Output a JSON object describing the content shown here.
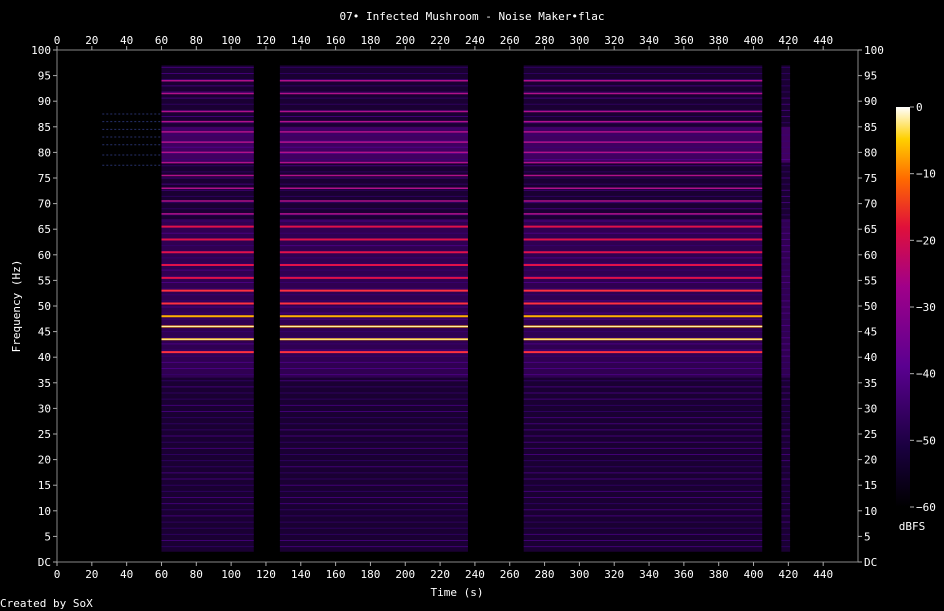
{
  "chart_data": {
    "type": "heatmap",
    "title": "07• Infected Mushroom - Noise Maker•flac",
    "xlabel": "Time (s)",
    "ylabel": "Frequency (Hz)",
    "xlim": [
      0,
      460
    ],
    "ylim": [
      0,
      100
    ],
    "x_ticks": [
      0,
      20,
      40,
      60,
      80,
      100,
      120,
      140,
      160,
      180,
      200,
      220,
      240,
      260,
      280,
      300,
      320,
      340,
      360,
      380,
      400,
      420,
      440
    ],
    "y_ticks": [
      "DC",
      "5",
      "10",
      "15",
      "20",
      "25",
      "30",
      "35",
      "40",
      "45",
      "50",
      "55",
      "60",
      "65",
      "70",
      "75",
      "80",
      "85",
      "90",
      "95",
      "100"
    ],
    "colorbar": {
      "label": "dBFS",
      "range": [
        -60,
        0
      ],
      "ticks": [
        "0",
        "−10",
        "−20",
        "−30",
        "−40",
        "−50",
        "−60"
      ],
      "colors": [
        "#000000",
        "#1a0040",
        "#5a0090",
        "#a0008a",
        "#e0103a",
        "#ff6a00",
        "#ffd000",
        "#ffffff"
      ]
    },
    "active_segments_s": [
      [
        60,
        113
      ],
      [
        128,
        236
      ],
      [
        268,
        405
      ],
      [
        416,
        421
      ]
    ],
    "quiet_segment_s": [
      [
        26,
        60
      ]
    ],
    "strong_partials_hz": [
      41,
      43.5,
      46,
      48,
      50.5,
      53,
      55.5,
      58,
      60.5,
      63,
      65.5
    ]
  },
  "footer": {
    "credit": "Created by SoX"
  }
}
